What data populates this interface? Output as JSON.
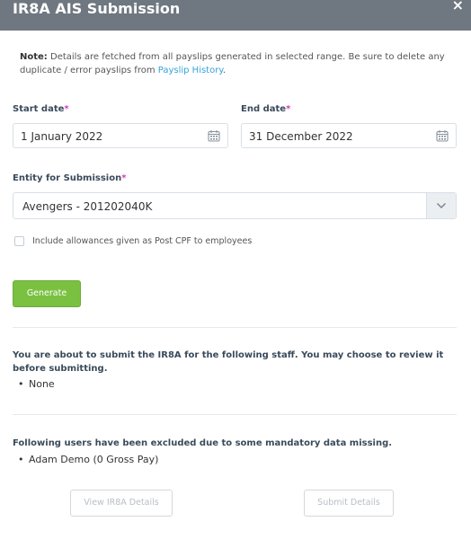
{
  "modal": {
    "title": "IR8A AIS Submission",
    "close": "×"
  },
  "note": {
    "prefix": "Note:",
    "text": " Details are fetched from all payslips generated in selected range. Be sure to delete any duplicate / error payslips from ",
    "link": "Payslip History",
    "suffix": "."
  },
  "start_date": {
    "label": "Start date",
    "required_mark": "*",
    "value": "1 January 2022",
    "icon": "calendar-icon"
  },
  "end_date": {
    "label": "End date",
    "required_mark": "*",
    "value": "31 December 2022",
    "icon": "calendar-icon"
  },
  "entity": {
    "label": "Entity for Submission",
    "required_mark": "*",
    "value": "Avengers - 201202040K",
    "icon": "chevron-down-icon"
  },
  "checkbox": {
    "label": "Include allowances given as Post CPF to employees",
    "checked": false
  },
  "generate_button": "Generate",
  "submit_section": {
    "text": "You are about to submit the IR8A for the following staff. You may choose to review it before submitting.",
    "items": [
      "None"
    ]
  },
  "excluded_section": {
    "text": "Following users have been excluded due to some mandatory data missing.",
    "items": [
      "Adam Demo (0 Gross Pay)"
    ]
  },
  "buttons": {
    "view": "View IR8A Details",
    "submit": "Submit Details"
  },
  "colors": {
    "header": "#6f7780",
    "required": "#d23cc0",
    "link": "#36a3d6",
    "generate": "#7ac142"
  }
}
